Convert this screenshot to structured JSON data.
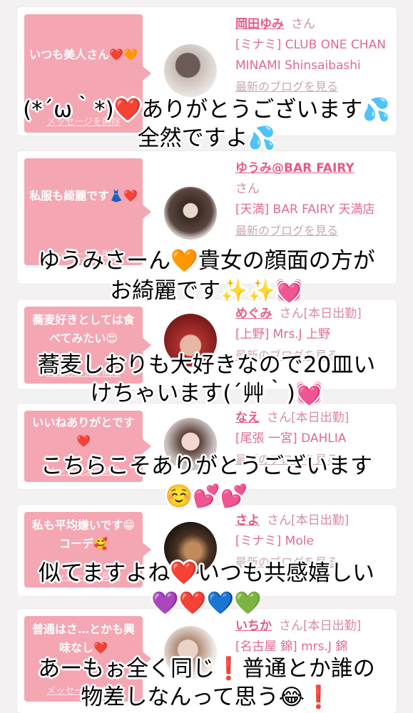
{
  "cards": [
    {
      "bubble_text": "いつも美人さん❤️🧡",
      "delete_label": "メッセージを削除",
      "name": "岡田ゆみ",
      "honorific": "さん",
      "status": "",
      "shop": "[ミナミ] CLUB ONE CHAN MINAMI Shinsaibashi",
      "blog_link": "最新のブログを見る"
    },
    {
      "bubble_text": "私服も綺麗です👗❤️",
      "delete_label": "メッセージを削除",
      "name": "ゆうみ@BAR FAIRY",
      "honorific": "さん",
      "status": "",
      "shop": "[天満] BAR FAIRY 天満店",
      "blog_link": "最新のブログを見る"
    },
    {
      "bubble_text": "蕎麦好きとしては食べてみたい😍",
      "delete_label": "メッセージを削除",
      "name": "めぐみ",
      "honorific": "さん",
      "status": "[本日出勤]",
      "shop": "[上野] Mrs.J 上野",
      "blog_link": "最新のブログを見る"
    },
    {
      "bubble_text": "いいねありがとです❤️",
      "delete_label": "メッセージを削除",
      "name": "なえ",
      "honorific": "さん",
      "status": "[本日出勤]",
      "shop": "[尾張 一宮] DAHLIA",
      "blog_link": "最新のブログを見る"
    },
    {
      "bubble_text": "私も平均嫌いです😁コーデ🥰",
      "delete_label": "メッセージを削除",
      "name": "さよ",
      "honorific": "さん",
      "status": "[本日出勤]",
      "shop": "[ミナミ] Mole",
      "blog_link": "最新のブログを見る"
    },
    {
      "bubble_text": "普通はさ…とかも興味なし❤️",
      "delete_label": "メッセージを削除",
      "name": "いちか",
      "honorific": "さん",
      "status": "[本日出勤]",
      "shop": "[名古屋 錦] mrs.J 錦",
      "blog_link": ""
    }
  ],
  "overlays": [
    "(*´ω｀*)❤️ありがとうございます💦",
    "全然ですよ💦",
    "ゆうみさーん🧡貴女の顔面の方が",
    "お綺麗です✨✨💓",
    "蕎麦しおりも大好きなので20皿い",
    "けちゃいます(´艸｀)💓",
    "こちらこそありがとうございます",
    "☺️💕💕",
    "似てますよね❤️いつも共感嬉しい",
    "💜❤️💙💚",
    "あーもぉ全く同じ❗️普通とか誰の",
    "物差しなんって思う😂❗️"
  ],
  "colors": {
    "accent_pink": "#f4a6b2",
    "name_pink": "#e45b84",
    "background": "#f3f1f2"
  }
}
